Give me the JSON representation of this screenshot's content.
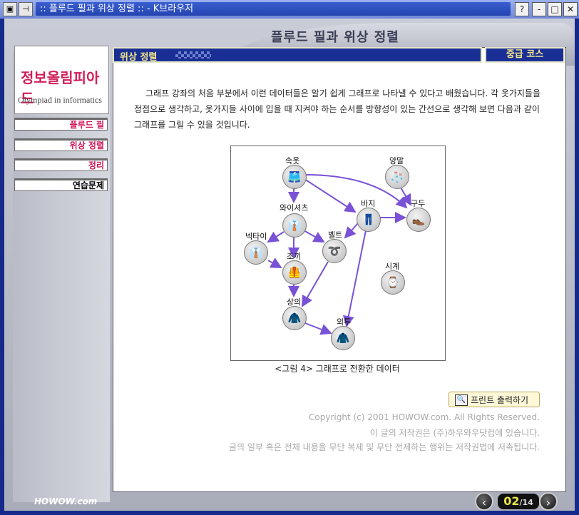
{
  "window": {
    "title": ":: 플루드 필과 위상 정렬 :: - K브라우저",
    "help_btn": "?",
    "min_btn": "-",
    "max_btn": "□",
    "close_btn": "✕"
  },
  "header": {
    "title": "플루드 필과 위상 정렬"
  },
  "logo": {
    "korean": "정보올림피아드",
    "english": "Olympiad in informatics"
  },
  "sidebar": {
    "items": [
      {
        "label": "플루드 필",
        "color": "#d0185c"
      },
      {
        "label": "위상 정렬",
        "color": "#d0185c"
      },
      {
        "label": "정리",
        "color": "#d0185c"
      },
      {
        "label": "연습문제",
        "color": "#000000"
      }
    ]
  },
  "section": {
    "title": "위상 정렬",
    "level": "중급 코스"
  },
  "content": {
    "paragraph": "그래프 강좌의 처음 부분에서 이런 데이터들은 알기 쉽게 그래프로 나타낼 수 있다고 배웠습니다. 각 옷가지들을 정점으로 생각하고, 옷가지들 사이에 입을 때 지켜야 하는 순서를 방향성이 있는 간선으로 생각해 보면 다음과 같이 그래프를 그릴 수 있을 것입니다.",
    "figure_caption": "<그림 4> 그래프로 전환한 데이터"
  },
  "graph": {
    "nodes": [
      {
        "id": "sokot",
        "label": "속옷",
        "icon": "shorts-icon"
      },
      {
        "id": "yangmal",
        "label": "양말",
        "icon": "sock-icon"
      },
      {
        "id": "waisyeocheu",
        "label": "와이셔츠",
        "icon": "shirt-icon"
      },
      {
        "id": "baji",
        "label": "바지",
        "icon": "pants-icon"
      },
      {
        "id": "gudu",
        "label": "구두",
        "icon": "shoe-icon"
      },
      {
        "id": "nektai",
        "label": "넥타이",
        "icon": "tie-icon"
      },
      {
        "id": "belt",
        "label": "벨트",
        "icon": "belt-icon"
      },
      {
        "id": "jokki",
        "label": "조끼",
        "icon": "vest-icon"
      },
      {
        "id": "sigye",
        "label": "시계",
        "icon": "watch-icon"
      },
      {
        "id": "sangui",
        "label": "상의",
        "icon": "jacket-icon"
      },
      {
        "id": "oetu",
        "label": "외투",
        "icon": "coat-icon"
      }
    ],
    "edge_color": "#7a52d6"
  },
  "actions": {
    "print_label": "프린트 출력하기"
  },
  "copyright": {
    "line1": "Copyright (c) 2001 HOWOW.com. All Rights Reserved.",
    "line2": "이 글의 저작권은 (주)하우와우닷컴에 있습니다.",
    "line3": "글의 일부 혹은 전체 내용을 무단 복제 및 무단 전제하는 행위는 저작권법에 저촉됩니다."
  },
  "footer": {
    "brand": "HOWOW.com",
    "page_current": "02",
    "page_total": "/14",
    "prev": "‹",
    "next": "›"
  }
}
